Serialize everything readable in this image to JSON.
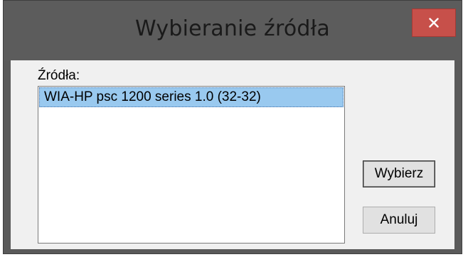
{
  "window": {
    "title": "Wybieranie źródła",
    "close_icon": "close-icon"
  },
  "sources": {
    "label": "Źródła:",
    "items": [
      {
        "label": "WIA-HP psc 1200 series 1.0 (32-32)",
        "selected": true
      }
    ]
  },
  "buttons": {
    "select_label": "Wybierz",
    "cancel_label": "Anuluj"
  },
  "colors": {
    "titlebar": "#5c5c5c",
    "close_button": "#c7504a",
    "selection": "#99c9ef",
    "client_background": "#f0f0f0"
  }
}
